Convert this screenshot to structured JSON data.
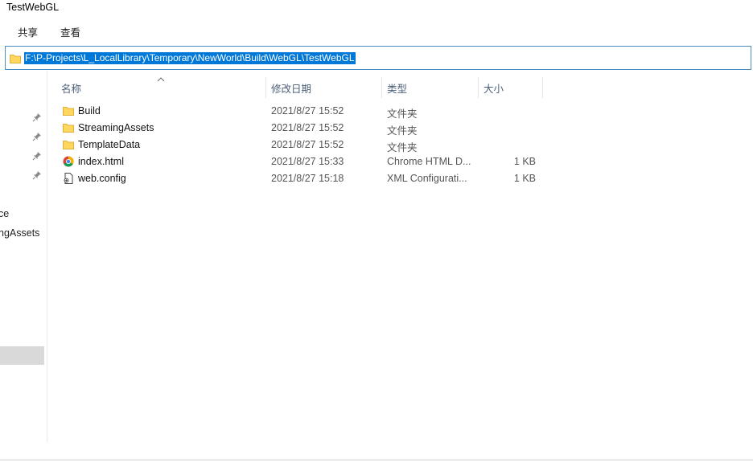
{
  "window": {
    "title": "TestWebGL"
  },
  "ribbon": {
    "tabs": [
      "共享",
      "查看"
    ]
  },
  "address_bar": {
    "path": "F:\\P-Projects\\L_LocalLibrary\\Temporary\\NewWorld\\Build\\WebGL\\TestWebGL"
  },
  "nav_pane": {
    "items": [
      "ce",
      "ngAssets"
    ]
  },
  "columns": {
    "name": "名称",
    "date": "修改日期",
    "type": "类型",
    "size": "大小"
  },
  "files": [
    {
      "name": "Build",
      "date": "2021/8/27 15:52",
      "type": "文件夹",
      "size": "",
      "icon": "folder-icon"
    },
    {
      "name": "StreamingAssets",
      "date": "2021/8/27 15:52",
      "type": "文件夹",
      "size": "",
      "icon": "folder-icon"
    },
    {
      "name": "TemplateData",
      "date": "2021/8/27 15:52",
      "type": "文件夹",
      "size": "",
      "icon": "folder-icon"
    },
    {
      "name": "index.html",
      "date": "2021/8/27 15:33",
      "type": "Chrome HTML D...",
      "size": "1 KB",
      "icon": "chrome-icon"
    },
    {
      "name": "web.config",
      "date": "2021/8/27 15:18",
      "type": "XML Configurati...",
      "size": "1 KB",
      "icon": "config-file-icon"
    }
  ]
}
